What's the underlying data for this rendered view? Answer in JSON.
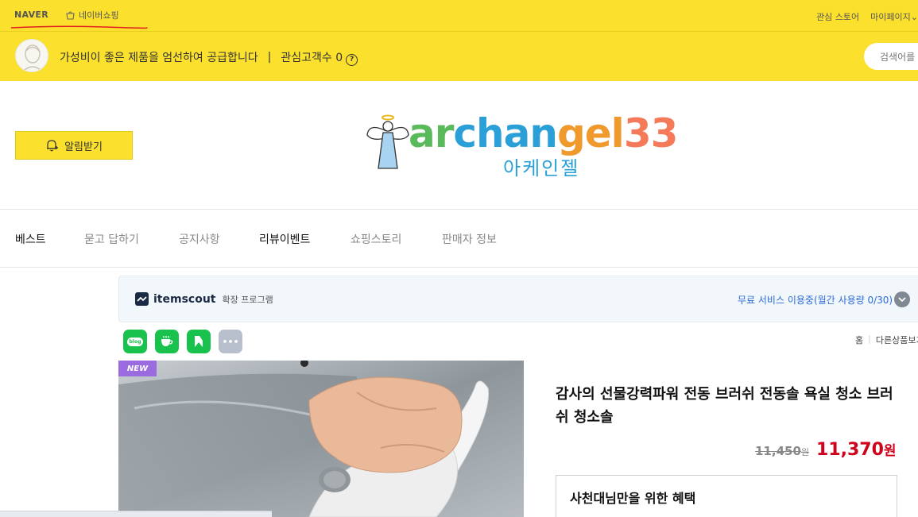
{
  "topbar": {
    "naver": "NAVER",
    "shopping": "네이버쇼핑",
    "right_items": [
      "관심 스토어",
      "마이페이지"
    ]
  },
  "store": {
    "description": "가성비이 좋은 제품을 엄선하여 공급합니다",
    "interest_label": "관심고객수 0",
    "search_placeholder": "검색어를"
  },
  "brand": {
    "alarm_label": "알림받기",
    "logo_parts": [
      "ar",
      "chan",
      "gel",
      "33"
    ],
    "logo_sub": "아케인젤"
  },
  "nav": {
    "items": [
      "베스트",
      "묻고 답하기",
      "공지사항",
      "리뷰이벤트",
      "쇼핑스토리",
      "판매자 정보"
    ]
  },
  "itemscout": {
    "name": "itemscout",
    "subtitle": "확장 프로그램",
    "free_text": "무료 서비스 이용중(월간 사용량 0/30)"
  },
  "share": {
    "blog_label": "blog",
    "more_label": "•••"
  },
  "breadcrumb": {
    "home": "홈",
    "other": "다른상품보기"
  },
  "product": {
    "badge": "NEW",
    "title": "감사의 선물강력파워 전동 브러쉬 전동솔 욕실 청소 브러쉬 청소솔",
    "old_price": "11,450",
    "old_currency": "원",
    "price": "11,370",
    "currency": "원",
    "benefit_title": "사천대님만을 위한 혜택"
  },
  "colors": {
    "naver_yellow": "#fbe02d",
    "price_red": "#d0021b",
    "link_blue": "#2b6bd6",
    "badge_purple": "#9b6be0"
  }
}
